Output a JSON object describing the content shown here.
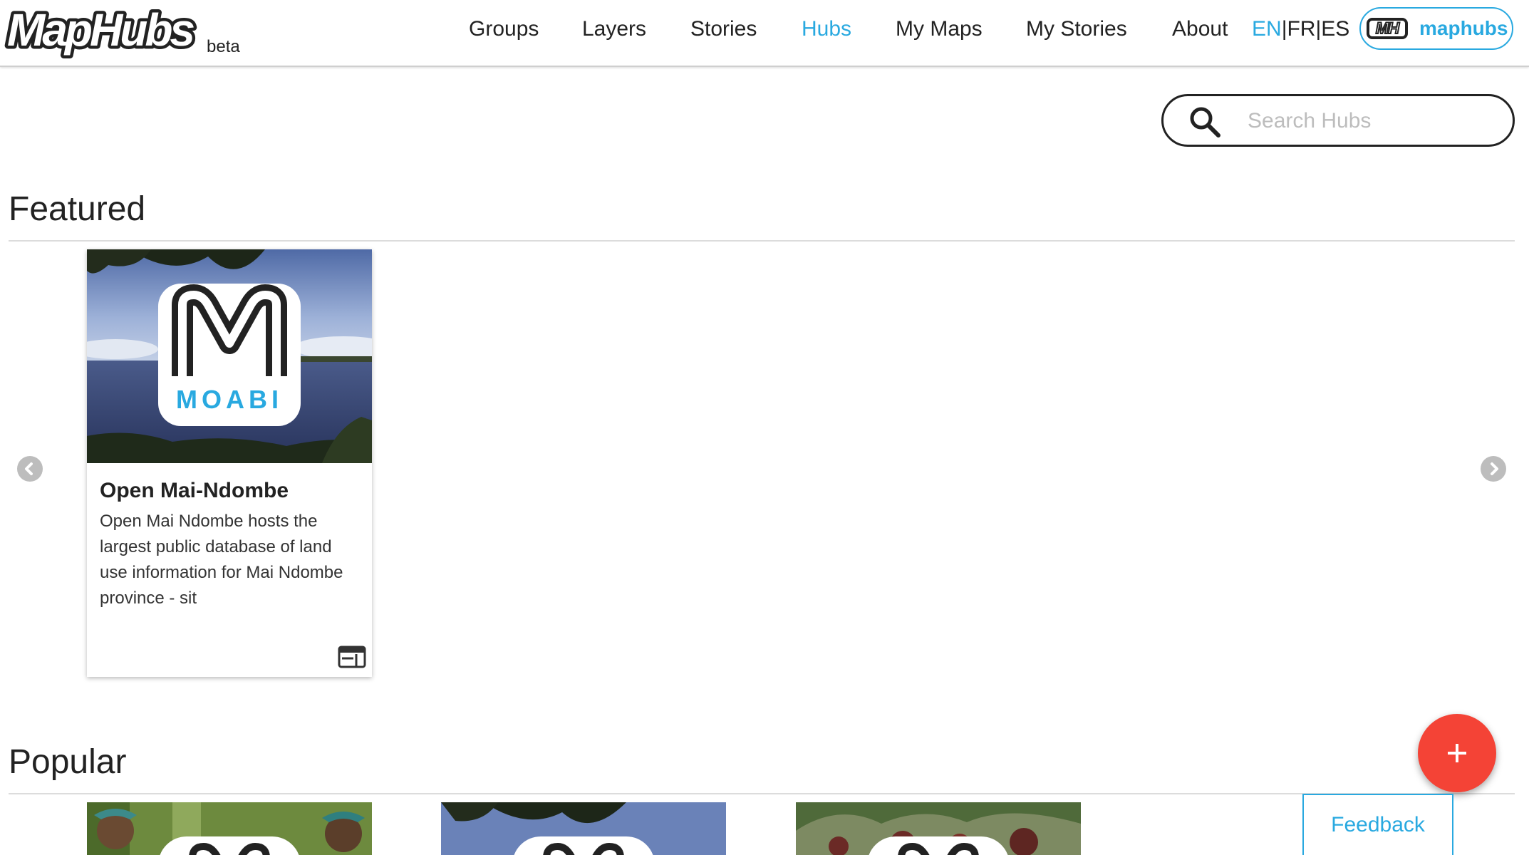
{
  "header": {
    "logo_text": "MapHubs",
    "beta_label": "beta",
    "nav": [
      {
        "label": "Groups",
        "active": false
      },
      {
        "label": "Layers",
        "active": false
      },
      {
        "label": "Stories",
        "active": false
      },
      {
        "label": "Hubs",
        "active": true
      },
      {
        "label": "My Maps",
        "active": false
      },
      {
        "label": "My Stories",
        "active": false
      },
      {
        "label": "About",
        "active": false
      }
    ],
    "languages": {
      "en": "EN",
      "fr": "FR",
      "es": "ES",
      "separator": "|",
      "active": "EN"
    },
    "account": {
      "badge": "MH",
      "label": "maphubs"
    }
  },
  "search": {
    "placeholder": "Search Hubs",
    "value": "",
    "icon": "search-icon"
  },
  "featured": {
    "title": "Featured",
    "cards": [
      {
        "badge_text": "MOABI",
        "title": "Open Mai-Ndombe",
        "description": "Open Mai Ndombe hosts the largest public database of land use information for Mai Ndombe province - sit",
        "icon": "web-page-icon"
      }
    ]
  },
  "popular": {
    "title": "Popular",
    "card_count": 3
  },
  "fab": {
    "icon": "plus-icon"
  },
  "feedback": {
    "label": "Feedback"
  },
  "colors": {
    "accent": "#29a9e0",
    "fab": "#f44336",
    "text": "#222222"
  }
}
